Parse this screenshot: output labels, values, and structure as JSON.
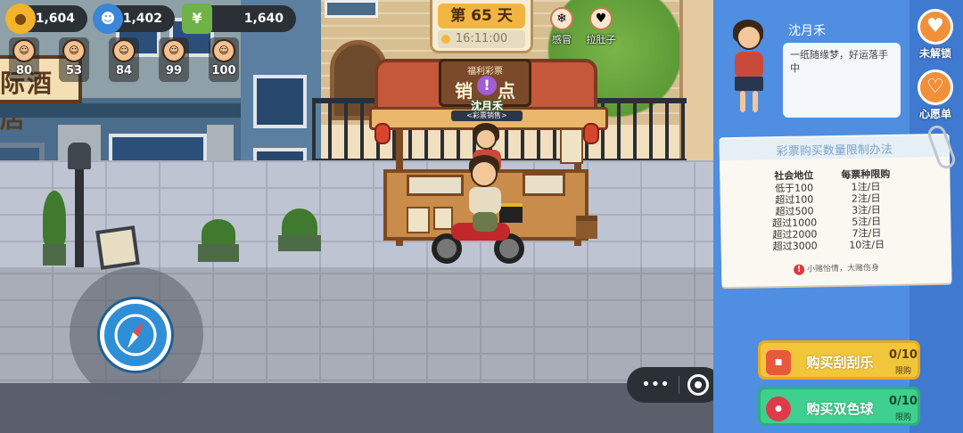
{
  "hud": {
    "currencies": [
      {
        "icon": "gold-coin-icon",
        "value": "1,604",
        "color": "#f3b32a"
      },
      {
        "icon": "blue-person-coin-icon",
        "value": "1,402",
        "color": "#3a86d8"
      },
      {
        "icon": "cash-stack-icon",
        "value": "1,640",
        "color": "#6fb24a"
      }
    ],
    "stats": [
      {
        "icon": "hunger-face-icon",
        "value": "80"
      },
      {
        "icon": "happy-face-icon",
        "value": "53"
      },
      {
        "icon": "money-face-icon",
        "value": "84"
      },
      {
        "icon": "health-face-icon",
        "value": "99"
      },
      {
        "icon": "style-face-icon",
        "value": "100"
      }
    ],
    "day_label": "第 65 天",
    "time": "16:11:00",
    "status_effects": [
      {
        "icon": "cold-icon",
        "label": "感冒"
      },
      {
        "icon": "stomach-icon",
        "label": "拉肚子"
      }
    ]
  },
  "scene": {
    "shop_sign": "际酒店",
    "stall_header": "福利彩票",
    "stall_title_left": "销",
    "stall_title_right": "点",
    "stall_alert": "!",
    "stall_npc_name": "沈月禾",
    "stall_npc_role": "<彩票销售>"
  },
  "controls": {
    "joystick_icon": "compass-icon",
    "menu_dots": "•••"
  },
  "panel": {
    "npc_name": "沈月禾",
    "npc_dialogue": "一纸随缘梦，好运落手中",
    "side_buttons": [
      {
        "icon": "heart-icon",
        "label": "未解锁",
        "color": "#f2903a"
      },
      {
        "icon": "wish-list-icon",
        "label": "心愿单",
        "color": "#f2903a"
      }
    ],
    "rules": {
      "title": "彩票购买数量限制办法",
      "headers": [
        "社会地位",
        "每票种限购"
      ],
      "rows": [
        [
          "低于100",
          "1注/日"
        ],
        [
          "超过100",
          "2注/日"
        ],
        [
          "超过500",
          "3注/日"
        ],
        [
          "超过1000",
          "5注/日"
        ],
        [
          "超过2000",
          "7注/日"
        ],
        [
          "超过3000",
          "10注/日"
        ]
      ],
      "footer": "小赌怡情，大赌伤身"
    },
    "buy_buttons": [
      {
        "label": "购买刮刮乐",
        "count": "0/10",
        "limit": "限购",
        "icon": "scratch-card-icon",
        "color": "#f2c63a"
      },
      {
        "label": "购买双色球",
        "count": "0/10",
        "limit": "限购",
        "icon": "double-color-ball-icon",
        "color": "#3fcf8e"
      }
    ]
  }
}
